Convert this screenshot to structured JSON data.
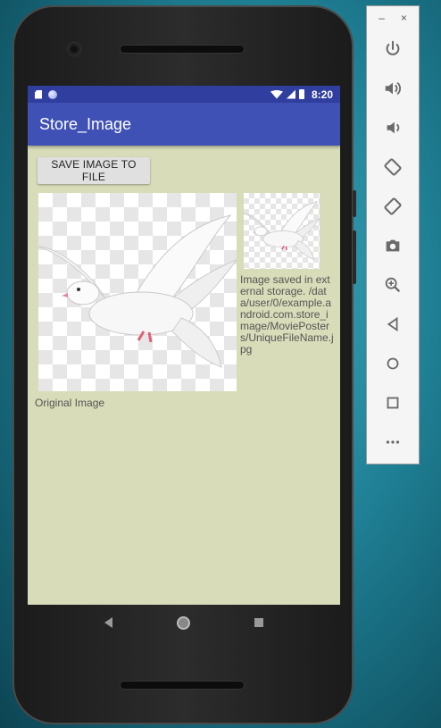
{
  "status_bar": {
    "time": "8:20"
  },
  "app_bar": {
    "title": "Store_Image"
  },
  "save_button": {
    "label": "SAVE IMAGE TO FILE"
  },
  "saved_message": "Image saved in external storage. /data/user/0/example.android.com.store_image/MoviePosters/UniqueFileName.jpg",
  "original_caption": "Original Image",
  "emulator": {
    "minimize": "–",
    "close": "×",
    "tools": [
      {
        "name": "power-icon"
      },
      {
        "name": "volume-up-icon"
      },
      {
        "name": "volume-down-icon"
      },
      {
        "name": "rotate-left-icon"
      },
      {
        "name": "rotate-right-icon"
      },
      {
        "name": "camera-icon"
      },
      {
        "name": "zoom-icon"
      },
      {
        "name": "back-icon"
      },
      {
        "name": "home-icon"
      },
      {
        "name": "overview-icon"
      },
      {
        "name": "more-icon"
      }
    ]
  },
  "colors": {
    "app_bar": "#3f51b5",
    "status_bar": "#303f9f",
    "screen_bg": "#d8dcb8"
  }
}
